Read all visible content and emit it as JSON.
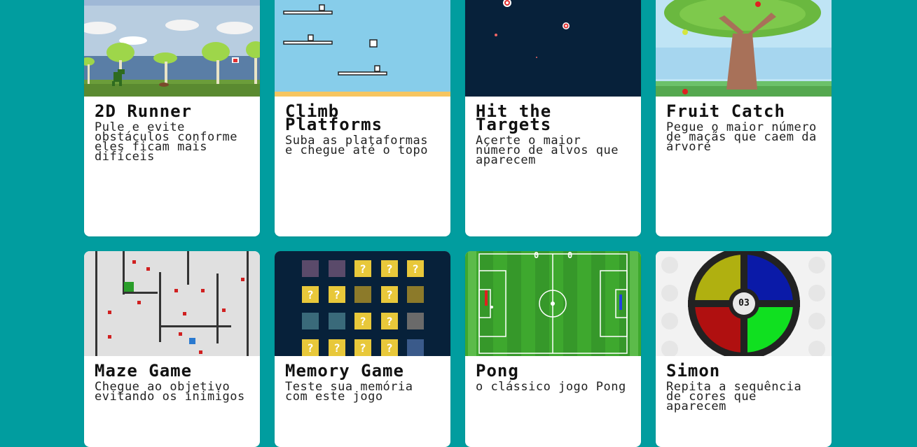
{
  "games": [
    {
      "title": "2D Runner",
      "description": "Pule e evite obstáculos conforme eles ficam mais difíceis"
    },
    {
      "title": "Climb Platforms",
      "description": "Suba as plataformas e chegue até o topo"
    },
    {
      "title": "Hit the Targets",
      "description": "Acerte o maior número de alvos que aparecem"
    },
    {
      "title": "Fruit Catch",
      "description": "Pegue o maior número de maçãs que caem da árvore"
    },
    {
      "title": "Maze Game",
      "description": "Chegue ao objetivo evitando os inimigos"
    },
    {
      "title": "Memory Game",
      "description": "Teste sua memória com este jogo"
    },
    {
      "title": "Pong",
      "description": "o clássico jogo Pong"
    },
    {
      "title": "Simon",
      "description": "Repita a sequência de cores que aparecem"
    }
  ],
  "simon": {
    "counter": "03"
  },
  "colors": {
    "background": "#019d9f",
    "card": "#ffffff"
  }
}
